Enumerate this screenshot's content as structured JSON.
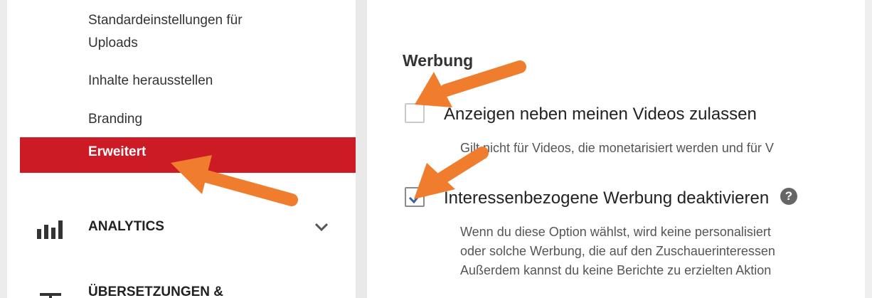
{
  "sidebar": {
    "items": [
      {
        "label_line1": "Standardeinstellungen für",
        "label_line2": "Uploads"
      },
      {
        "label": "Inhalte herausstellen"
      },
      {
        "label": "Branding"
      },
      {
        "label": "Erweitert",
        "active": true
      }
    ],
    "sections": [
      {
        "label": "ANALYTICS",
        "icon": "bar-chart-icon",
        "expand_icon": "chevron-down-icon"
      },
      {
        "label": "ÜBERSETZUNGEN &",
        "icon": "translation-icon"
      }
    ],
    "active_color": "#cc1b24"
  },
  "main": {
    "section_title": "Werbung",
    "options": [
      {
        "label": "Anzeigen neben meinen Videos zulassen",
        "checked": false,
        "description": [
          "Gilt nicht für Videos, die monetarisiert werden und für V"
        ]
      },
      {
        "label": "Interessenbezogene Werbung deaktivieren",
        "checked": true,
        "help_icon": "?",
        "description": [
          "Wenn du diese Option wählst, wird keine personalisiert",
          "oder solche Werbung, die auf den Zuschauerinteressen",
          "Außerdem kannst du keine Berichte zu erzielten Aktion"
        ]
      }
    ]
  },
  "annotations": {
    "arrow_color": "#ef7d2d"
  }
}
